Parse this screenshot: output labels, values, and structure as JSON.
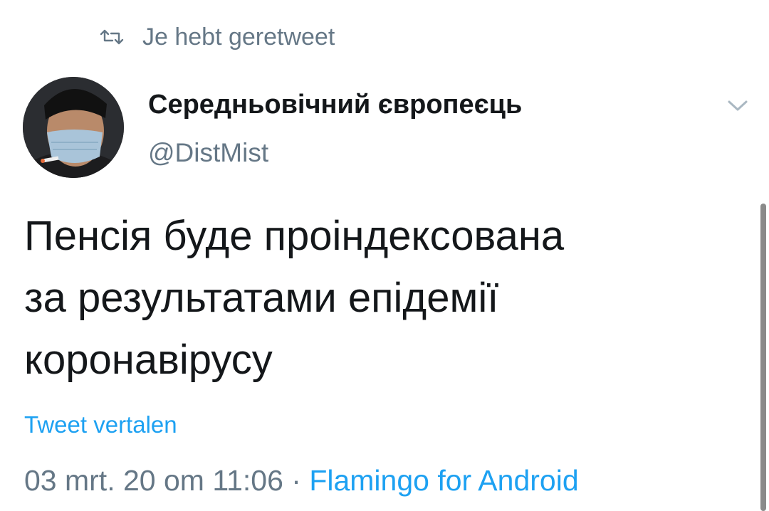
{
  "retweet": {
    "icon": "retweet-icon",
    "text": "Je hebt geretweet"
  },
  "author": {
    "name": "Середньовічний європеєць",
    "handle": "@DistMist",
    "avatar_icon": "avatar"
  },
  "menu": {
    "icon": "chevron-down-icon"
  },
  "tweet": {
    "lines": [
      "Пенсія буде проіндексована",
      "за результатами епідемії",
      "коронавірусу"
    ]
  },
  "translate_label": "Tweet vertalen",
  "meta": {
    "timestamp": "03 mrt. 20 om 11:06",
    "separator": " · ",
    "source": "Flamingo for Android"
  },
  "colors": {
    "accent": "#1da1f2",
    "secondary_text": "#657786",
    "primary_text": "#14171a"
  }
}
